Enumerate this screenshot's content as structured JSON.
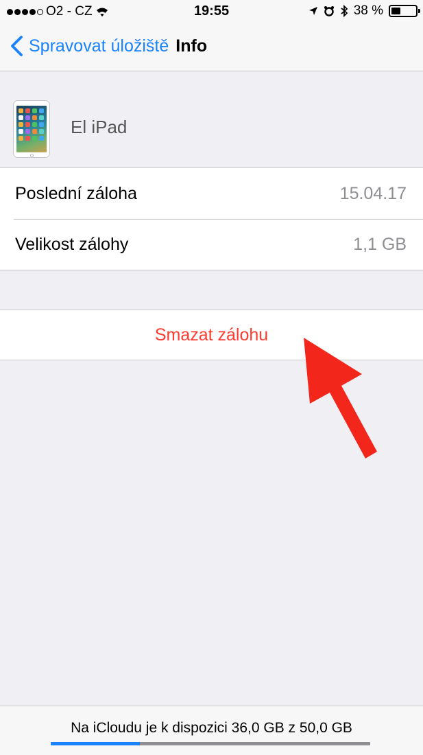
{
  "status_bar": {
    "carrier": "O2 - CZ",
    "time": "19:55",
    "battery_percent": "38 %",
    "battery_level": 0.38,
    "signal_bars_filled": 4,
    "signal_bars_total": 5,
    "icons": [
      "wifi-icon",
      "location-arrow-icon",
      "alarm-icon",
      "bluetooth-icon",
      "battery-icon"
    ]
  },
  "nav": {
    "back_label": "Spravovat úložiště",
    "title": "Info"
  },
  "device": {
    "name": "El iPad",
    "icon": "ipad-icon"
  },
  "info_rows": [
    {
      "label": "Poslední záloha",
      "value": "15.04.17"
    },
    {
      "label": "Velikost zálohy",
      "value": "1,1 GB"
    }
  ],
  "actions": {
    "delete_label": "Smazat zálohu"
  },
  "annotation": {
    "icon": "red-arrow-annotation",
    "color": "#f3261c"
  },
  "storage": {
    "text": "Na iCloudu je k dispozici 36,0 GB z 50,0 GB",
    "used_fraction": 0.28
  },
  "colors": {
    "accent": "#1a82fb",
    "destructive": "#ff3b30",
    "secondary_text": "#8e8e93",
    "background": "#efeff4"
  }
}
